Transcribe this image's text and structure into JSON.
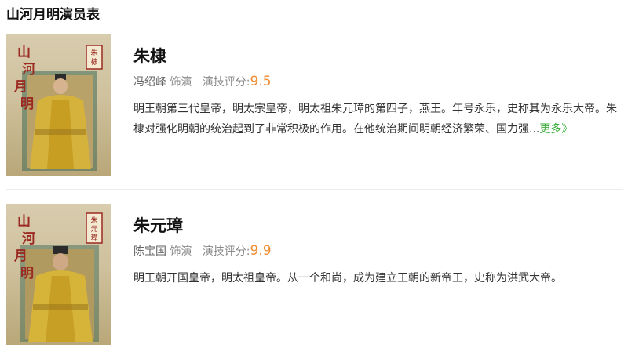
{
  "page": {
    "title": "山河月明演员表"
  },
  "cast": [
    {
      "character": "朱棣",
      "actor": "冯绍峰",
      "role_label": "饰演",
      "score_label": "演技评分:",
      "score": "9.5",
      "desc": "明王朝第三代皇帝，明太宗皇帝，明太祖朱元璋的第四子，燕王。年号永乐，史称其为永乐大帝。朱棣对强化明朝的统治起到了非常积极的作用。在他统治期间明朝经济繁荣、国力强...",
      "more": "更多》",
      "poster": {
        "logo_text": "山河月明",
        "seal_text": "朱棣"
      }
    },
    {
      "character": "朱元璋",
      "actor": "陈宝国",
      "role_label": "饰演",
      "score_label": "演技评分:",
      "score": "9.9",
      "desc": "明王朝开国皇帝，明太祖皇帝。从一个和尚，成为建立王朝的新帝王，史称为洪武大帝。",
      "poster": {
        "logo_text": "山河月明",
        "seal_text": "朱元璋"
      }
    }
  ]
}
